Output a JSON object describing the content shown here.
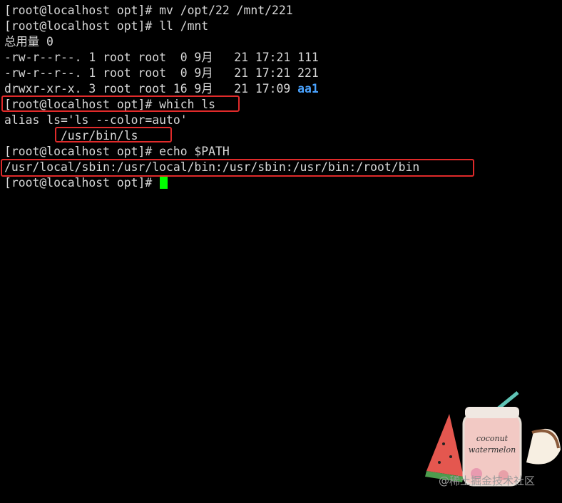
{
  "terminal": {
    "lines": [
      {
        "text": "[root@localhost opt]# mv /opt/22 /mnt/221"
      },
      {
        "text": "[root@localhost opt]# ll /mnt"
      },
      {
        "text": "总用量 0"
      },
      {
        "text": "-rw-r--r--. 1 root root  0 9月   21 17:21 111"
      },
      {
        "text": "-rw-r--r--. 1 root root  0 9月   21 17:21 221"
      },
      {
        "prefix": "drwxr-xr-x. 3 root root 16 9月   21 17:09 ",
        "dirname": "aa1"
      },
      {
        "text": "[root@localhost opt]# which ls"
      },
      {
        "text": "alias ls='ls --color=auto'"
      },
      {
        "text": "        /usr/bin/ls"
      },
      {
        "text": "[root@localhost opt]# echo $PATH"
      },
      {
        "text": "/usr/local/sbin:/usr/local/bin:/usr/sbin:/usr/bin:/root/bin"
      },
      {
        "text": "[root@localhost opt]# "
      }
    ],
    "cursor_color": "#00ff00",
    "directory_color": "#4aa3ff",
    "highlight_color": "#e02a2a"
  },
  "sticker": {
    "icon": "watermelon-coconut-sticker-icon",
    "text": "coconut watermelon"
  },
  "watermark": {
    "text": "@稀土掘金技术社区"
  }
}
